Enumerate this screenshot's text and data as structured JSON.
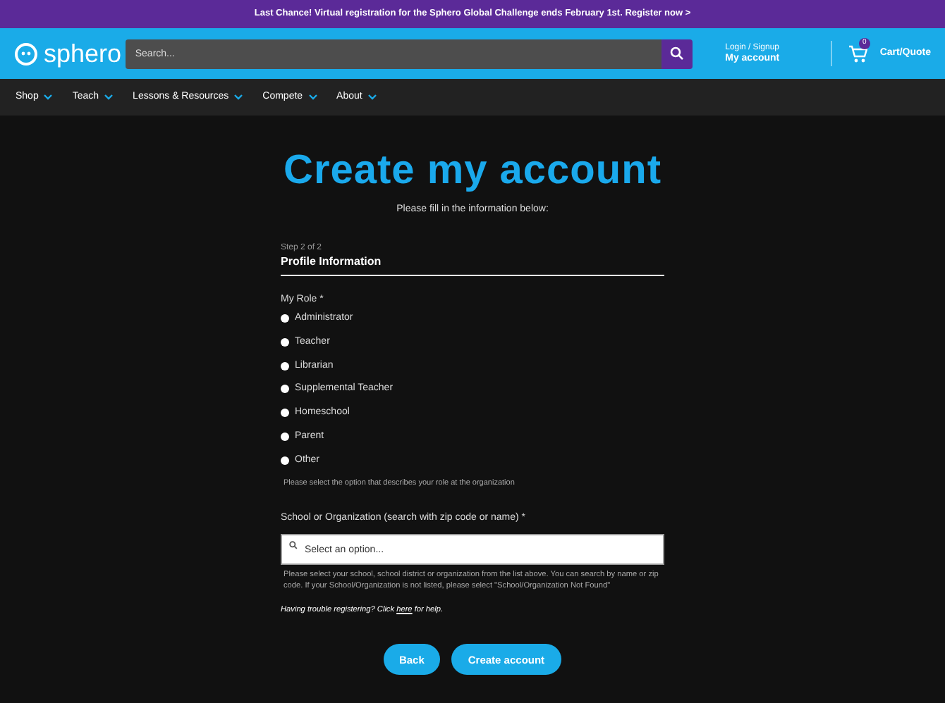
{
  "banner": {
    "text": "Last Chance! Virtual registration for the Sphero Global Challenge ends February 1st. Register now >"
  },
  "header": {
    "logo": "sphero",
    "search": {
      "placeholder": "Search..."
    },
    "account": {
      "line1": "Login / Signup",
      "line2": "My account"
    },
    "cart": {
      "count": "0",
      "label": "Cart/Quote"
    }
  },
  "nav": [
    {
      "label": "Shop"
    },
    {
      "label": "Teach"
    },
    {
      "label": "Lessons & Resources"
    },
    {
      "label": "Compete"
    },
    {
      "label": "About"
    }
  ],
  "title": "Create my account",
  "subtitle": "Please fill in the information below:",
  "step": "Step 2 of 2",
  "section": "Profile Information",
  "role": {
    "label": "My Role *",
    "options": [
      {
        "label": "Administrator",
        "selected": false
      },
      {
        "label": "Teacher",
        "selected": false
      },
      {
        "label": "Librarian",
        "selected": false
      },
      {
        "label": "Supplemental Teacher",
        "selected": false
      },
      {
        "label": "Homeschool",
        "selected": false
      },
      {
        "label": "Parent",
        "selected": false
      },
      {
        "label": "Other",
        "selected": false
      }
    ],
    "hint": "Please select the option that describes your role at the organization"
  },
  "school": {
    "label": "School or Organization (search with zip code or name) *",
    "placeholder": "Select an option...",
    "hint": "Please select your school, school district or organization from the list above. You can search by name or zip code. If your School/Organization is not listed, please select \"School/Organization Not Found\""
  },
  "help": {
    "before": "Having trouble registering? Click ",
    "link": "here",
    "after": " for help."
  },
  "buttons": [
    {
      "label": "Back"
    },
    {
      "label": "Create account"
    }
  ]
}
